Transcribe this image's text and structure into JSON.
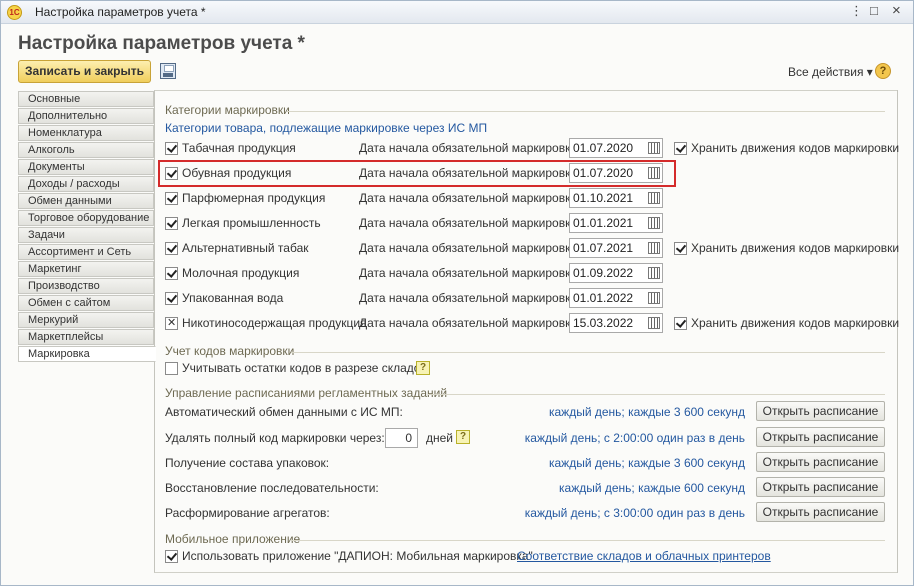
{
  "window": {
    "title": "Настройка параметров учета *",
    "logo": "1С",
    "btn_more": "⋮",
    "btn_maximize": "□",
    "btn_close": "×"
  },
  "form": {
    "title": "Настройка параметров учета *",
    "save_close_label": "Записать и закрыть",
    "all_actions_label": "Все действия ▾",
    "help_label": "?"
  },
  "sidebar": {
    "items": [
      {
        "label": "Основные"
      },
      {
        "label": "Дополнительно"
      },
      {
        "label": "Номенклатура"
      },
      {
        "label": "Алкоголь"
      },
      {
        "label": "Документы"
      },
      {
        "label": "Доходы / расходы"
      },
      {
        "label": "Обмен данными"
      },
      {
        "label": "Торговое оборудование"
      },
      {
        "label": "Задачи"
      },
      {
        "label": "Ассортимент и Сеть"
      },
      {
        "label": "Маркетинг"
      },
      {
        "label": "Производство"
      },
      {
        "label": "Обмен с сайтом"
      },
      {
        "label": "Меркурий"
      },
      {
        "label": "Маркетплейсы"
      },
      {
        "label": "Маркировка"
      }
    ],
    "active_index": 15
  },
  "categories": {
    "group_title": "Категории маркировки",
    "link": "Категории товара, подлежащие маркировке через ИС МП",
    "date_label": "Дата начала обязательной маркировки:",
    "store_label": "Хранить движения кодов маркировки",
    "rows": [
      {
        "name": "Табачная продукция",
        "date": "01.07.2020",
        "checked": true,
        "store": true
      },
      {
        "name": "Обувная продукция",
        "date": "01.07.2020",
        "checked": true,
        "store": false
      },
      {
        "name": "Парфюмерная продукция",
        "date": "01.10.2021",
        "checked": true,
        "store": false
      },
      {
        "name": "Легкая промышленность",
        "date": "01.01.2021",
        "checked": true,
        "store": false
      },
      {
        "name": "Альтернативный табак",
        "date": "01.07.2021",
        "checked": true,
        "store": true
      },
      {
        "name": "Молочная продукция",
        "date": "01.09.2022",
        "checked": true,
        "store": false
      },
      {
        "name": "Упакованная вода",
        "date": "01.01.2022",
        "checked": true,
        "store": false
      },
      {
        "name": "Никотиносодержащая продукция",
        "date": "15.03.2022",
        "checked": "indeterminate",
        "store": true
      }
    ]
  },
  "codes": {
    "group_title": "Учет кодов маркировки",
    "stock_label": "Учитывать остатки кодов в разрезе складов",
    "stock_checked": false,
    "help": "?"
  },
  "schedules": {
    "group_title": "Управление расписаниями регламентных заданий",
    "open_label": "Открыть расписание",
    "days_value": "0",
    "days_unit": "дней",
    "help": "?",
    "rows": [
      {
        "label": "Автоматический обмен данными с ИС МП:",
        "schedule": "каждый день; каждые 3 600 секунд"
      },
      {
        "label": "Удалять полный код маркировки через:",
        "schedule": "каждый день; с 2:00:00 один раз в день"
      },
      {
        "label": "Получение состава упаковок:",
        "schedule": "каждый день; каждые 3 600 секунд"
      },
      {
        "label": "Восстановление последовательности:",
        "schedule": "каждый день; каждые 600 секунд"
      },
      {
        "label": "Расформирование агрегатов:",
        "schedule": "каждый день; с 3:00:00 один раз в день"
      }
    ]
  },
  "mobile": {
    "group_title": "Мобильное приложение",
    "use_label": "Использовать приложение \"ДАПИОН: Мобильная маркировка\"",
    "use_checked": true,
    "link": "Соответствие складов и облачных принтеров"
  },
  "colors": {
    "accent_yellow": "#f0ce5c",
    "link_blue": "#2458a0",
    "highlight_red": "#d42b2b",
    "group_title": "#6e6a52"
  }
}
